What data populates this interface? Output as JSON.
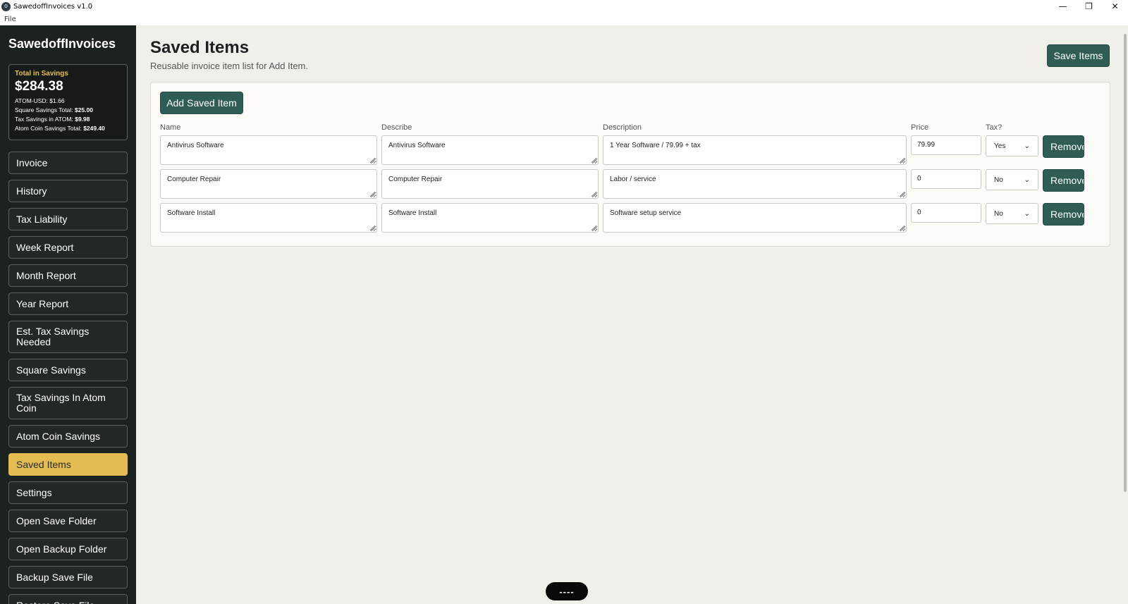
{
  "window": {
    "title": "SawedoffInvoices v1.0",
    "app_icon_glyph": "⚙",
    "minimize_glyph": "—",
    "maximize_glyph": "❐",
    "close_glyph": "✕"
  },
  "menu": {
    "file": "File"
  },
  "sidebar": {
    "brand": "SawedoffInvoices",
    "savings": {
      "label": "Total in Savings",
      "total": "$284.38",
      "atom_usd": "ATOM-USD: $1.66",
      "square_label": "Square Savings Total:",
      "square_value": "$25.00",
      "tax_atom_label": "Tax Savings in ATOM:",
      "tax_atom_value": "$9.98",
      "atom_coin_label": "Atom Coin Savings Total:",
      "atom_coin_value": "$249.40"
    },
    "nav": [
      {
        "label": "Invoice"
      },
      {
        "label": "History"
      },
      {
        "label": "Tax Liability"
      },
      {
        "label": "Week Report"
      },
      {
        "label": "Month Report"
      },
      {
        "label": "Year Report"
      },
      {
        "label": "Est. Tax Savings Needed"
      },
      {
        "label": "Square Savings"
      },
      {
        "label": "Tax Savings In Atom Coin"
      },
      {
        "label": "Atom Coin Savings"
      },
      {
        "label": "Saved Items"
      },
      {
        "label": "Settings"
      },
      {
        "label": "Open Save Folder"
      },
      {
        "label": "Open Backup Folder"
      },
      {
        "label": "Backup Save File"
      },
      {
        "label": "Restore Save File"
      }
    ],
    "active_item": "Saved Items"
  },
  "main": {
    "title": "Saved Items",
    "subtitle": "Reusable invoice item list for Add Item.",
    "save_button": "Save Items",
    "add_button": "Add Saved Item",
    "columns": {
      "name": "Name",
      "describe": "Describe",
      "description": "Description",
      "price": "Price",
      "tax": "Tax?"
    },
    "rows": [
      {
        "name": "Antivirus Software",
        "describe": "Antivirus Software",
        "description": "1 Year Software / 79.99 + tax",
        "price": "79.99",
        "tax": "Yes",
        "remove": "Remove"
      },
      {
        "name": "Computer Repair",
        "describe": "Computer Repair",
        "description": "Labor / service",
        "price": "0",
        "tax": "No",
        "remove": "Remove"
      },
      {
        "name": "Software Install",
        "describe": "Software Install",
        "description": "Software setup service",
        "price": "0",
        "tax": "No",
        "remove": "Remove"
      }
    ]
  },
  "bottom_pill": "----",
  "colors": {
    "sidebar_bg": "#1c221f",
    "accent_gold": "#e3bd52",
    "button_teal": "#2f5d55",
    "main_bg": "#f0efea"
  }
}
